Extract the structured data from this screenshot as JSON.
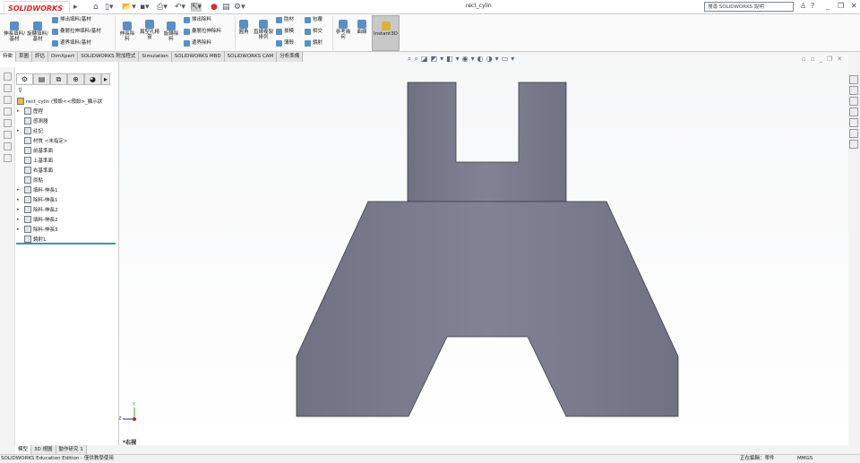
{
  "app": {
    "logo": "SOLIDWORKS",
    "doc_title": "rect_cylin",
    "search_placeholder": "搜尋 SOLIDWORKS 說明"
  },
  "ribbon": {
    "big": [
      "伸長填料/基材",
      "旋轉填料/基材",
      "伸長除料",
      "異型孔精靈",
      "旋轉除料",
      "圓角",
      "直線複製排列",
      "參考幾何",
      "曲線",
      "Instant3D"
    ],
    "small": [
      "掃出填料/基材",
      "疊層拉伸填料/基材",
      "邊界填料/基材",
      "掃出除料",
      "疊層拉伸除料",
      "邊界除料",
      "肋材",
      "拔模",
      "薄殼",
      "包覆",
      "相交",
      "鏡射"
    ]
  },
  "tabs": [
    {
      "label": "特徵",
      "active": true
    },
    {
      "label": "草圖"
    },
    {
      "label": "評估"
    },
    {
      "label": "DimXpert"
    },
    {
      "label": "SOLIDWORKS 附加程式"
    },
    {
      "label": "Simulation"
    },
    {
      "label": "SOLIDWORKS MBD"
    },
    {
      "label": "SOLIDWORKS CAM"
    },
    {
      "label": "分析準備"
    }
  ],
  "tree": {
    "root": "rect_cylin (預設<<預設>_顯示狀",
    "items": [
      {
        "label": "歷程",
        "exp": true
      },
      {
        "label": "感測器"
      },
      {
        "label": "註記",
        "exp": true
      },
      {
        "label": "材質 <未指定>"
      },
      {
        "label": "前基準面"
      },
      {
        "label": "上基準面"
      },
      {
        "label": "右基準面"
      },
      {
        "label": "原點"
      },
      {
        "label": "填料-伸長1",
        "exp": true
      },
      {
        "label": "除料-伸長1",
        "exp": true
      },
      {
        "label": "除料-伸長2",
        "exp": true
      },
      {
        "label": "填料-伸長2",
        "exp": true
      },
      {
        "label": "除料-伸長3",
        "exp": true
      },
      {
        "label": "鏡射1"
      }
    ]
  },
  "viewport": {
    "view_label": "*右視",
    "triad": {
      "y": "Y",
      "z": "Z"
    },
    "part_color": "#7a7e8e"
  },
  "bottom_tabs": [
    "模型",
    "3D 視圖",
    "動作研究 1"
  ],
  "status": {
    "left": "SOLIDWORKS Education Edition - 僅供教學使用",
    "editing": "正在編輯：零件",
    "units": "MMGS"
  }
}
